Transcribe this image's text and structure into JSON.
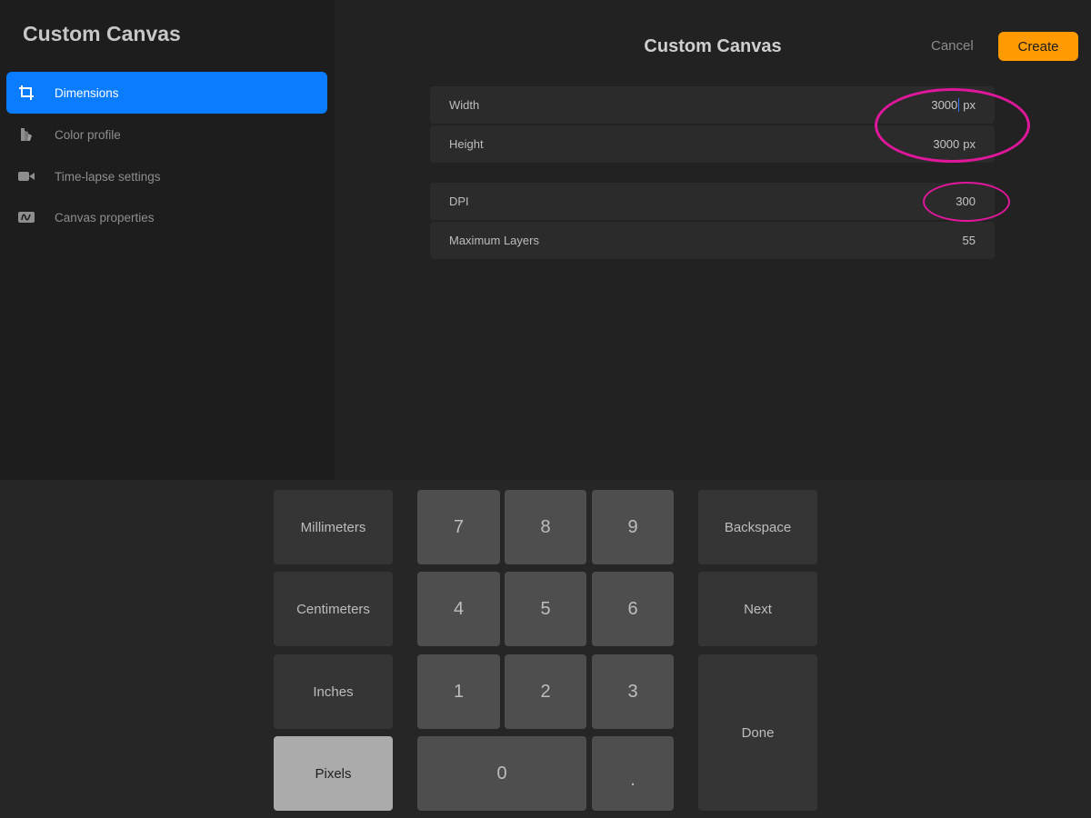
{
  "sidebar": {
    "title": "Custom Canvas",
    "items": [
      {
        "label": "Dimensions",
        "icon": "crop-icon",
        "active": true
      },
      {
        "label": "Color profile",
        "icon": "color-profile-icon",
        "active": false
      },
      {
        "label": "Time-lapse settings",
        "icon": "video-camera-icon",
        "active": false
      },
      {
        "label": "Canvas properties",
        "icon": "canvas-properties-icon",
        "active": false
      }
    ]
  },
  "header": {
    "title": "Custom Canvas",
    "cancel_label": "Cancel",
    "create_label": "Create"
  },
  "fields": {
    "width": {
      "label": "Width",
      "value": "3000",
      "unit": "px"
    },
    "height": {
      "label": "Height",
      "value": "3000",
      "unit": "px"
    },
    "dpi": {
      "label": "DPI",
      "value": "300"
    },
    "max_layers": {
      "label": "Maximum Layers",
      "value": "55"
    }
  },
  "keypad": {
    "units": [
      "Millimeters",
      "Centimeters",
      "Inches",
      "Pixels"
    ],
    "selected_unit": "Pixels",
    "digits": [
      "7",
      "8",
      "9",
      "4",
      "5",
      "6",
      "1",
      "2",
      "3"
    ],
    "zero": "0",
    "decimal": ".",
    "backspace_label": "Backspace",
    "next_label": "Next",
    "done_label": "Done"
  },
  "colors": {
    "accent": "#0a7cff",
    "create_button": "#ff9a00",
    "annotation": "#e0179b",
    "caret": "#2f74ff"
  }
}
